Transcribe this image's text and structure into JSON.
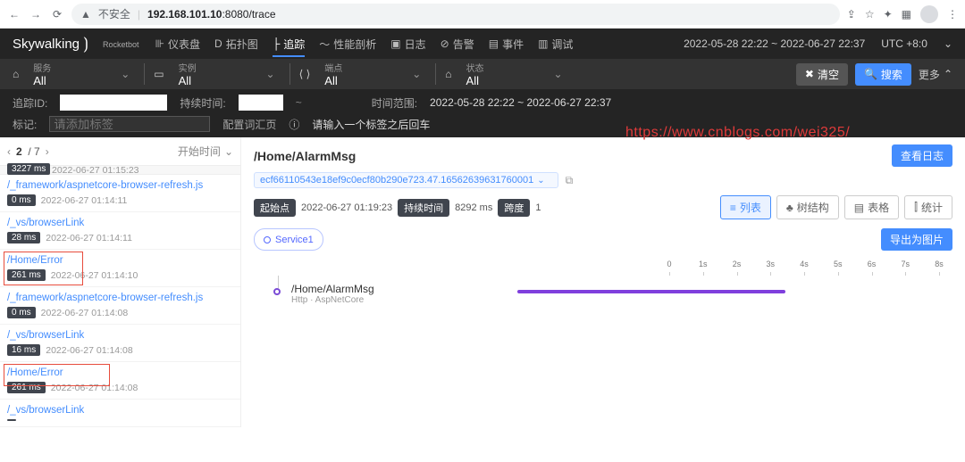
{
  "browser": {
    "insecure": "不安全",
    "host": "192.168.101.10",
    "port": ":8080",
    "path": "/trace"
  },
  "brand": {
    "name": "Skywalking",
    "sub": "Rocketbot"
  },
  "tabs": {
    "dashboard": "仪表盘",
    "topo": "拓扑图",
    "trace": "追踪",
    "profile": "性能剖析",
    "log": "日志",
    "alarm": "告警",
    "event": "事件",
    "debug": "调试"
  },
  "header": {
    "timerange": "2022-05-28 22:22 ~ 2022-06-27 22:37",
    "tz": "UTC +8:0"
  },
  "filter": {
    "service_lbl": "服务",
    "service": "All",
    "instance_lbl": "实例",
    "instance": "All",
    "endpoint_lbl": "端点",
    "endpoint": "All",
    "status_lbl": "状态",
    "status": "All",
    "clear": "清空",
    "search": "搜索",
    "more": "更多"
  },
  "sub": {
    "traceid": "追踪ID:",
    "duration": "持续时间:",
    "range_lbl": "时间范围:",
    "range": "2022-05-28 22:22 ~ 2022-06-27 22:37",
    "tag_lbl": "标记:",
    "tag_ph": "请添加标签",
    "dict": "配置词汇页",
    "hint": "请输入一个标签之后回车"
  },
  "left": {
    "page_cur": "2",
    "page_total": "/ 7",
    "sort": "开始时间",
    "top_pill": "3227 ms",
    "top_ts": "2022-06-27 01:15:23",
    "items": [
      {
        "path": "/_framework/aspnetcore-browser-refresh.js",
        "pill": "0 ms",
        "ts": "2022-06-27 01:14:11",
        "hl": 0
      },
      {
        "path": "/_vs/browserLink",
        "pill": "28 ms",
        "ts": "2022-06-27 01:14:11",
        "hl": 0
      },
      {
        "path": "/Home/Error",
        "pill": "261 ms",
        "ts": "2022-06-27 01:14:10",
        "hl": 1
      },
      {
        "path": "/_framework/aspnetcore-browser-refresh.js",
        "pill": "0 ms",
        "ts": "2022-06-27 01:14:08",
        "hl": 0
      },
      {
        "path": "/_vs/browserLink",
        "pill": "16 ms",
        "ts": "2022-06-27 01:14:08",
        "hl": 0
      },
      {
        "path": "/Home/Error",
        "pill": "261 ms",
        "ts": "2022-06-27 01:14:08",
        "hl": 2
      },
      {
        "path": "/_vs/browserLink",
        "pill": "",
        "ts": "",
        "hl": 0
      }
    ]
  },
  "right": {
    "title": "/Home/AlarmMsg",
    "viewlog": "查看日志",
    "id": "ecf66110543e18ef9c0ecf80b290e723.47.16562639631760001",
    "start_lbl": "起始点",
    "start": "2022-06-27 01:19:23",
    "dur_lbl": "持续时间",
    "dur": "8292 ms",
    "span_lbl": "跨度",
    "span": "1",
    "btns": {
      "list": "列表",
      "tree": "树结构",
      "table": "表格",
      "stat": "统计"
    },
    "service": "Service1",
    "export": "导出为图片",
    "ruler": [
      "0",
      "1s",
      "2s",
      "3s",
      "4s",
      "5s",
      "6s",
      "7s",
      "8s"
    ],
    "node": {
      "title": "/Home/AlarmMsg",
      "sub": "Http · AspNetCore"
    }
  },
  "watermark": "https://www.cnblogs.com/wei325/"
}
